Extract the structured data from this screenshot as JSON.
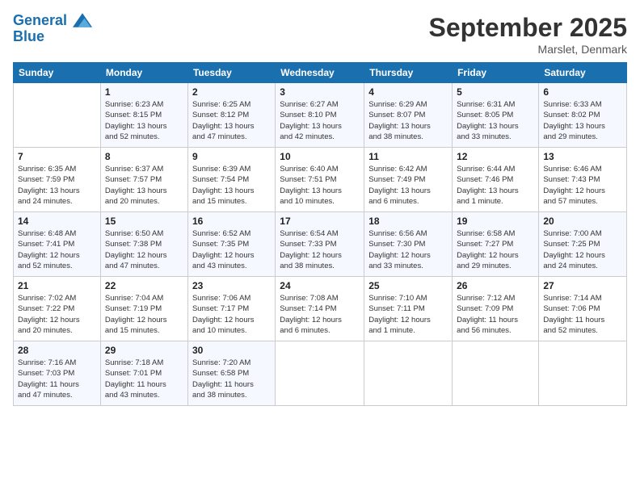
{
  "logo": {
    "line1": "General",
    "line2": "Blue"
  },
  "title": "September 2025",
  "location": "Marslet, Denmark",
  "days_header": [
    "Sunday",
    "Monday",
    "Tuesday",
    "Wednesday",
    "Thursday",
    "Friday",
    "Saturday"
  ],
  "weeks": [
    [
      {
        "num": "",
        "info": ""
      },
      {
        "num": "1",
        "info": "Sunrise: 6:23 AM\nSunset: 8:15 PM\nDaylight: 13 hours\nand 52 minutes."
      },
      {
        "num": "2",
        "info": "Sunrise: 6:25 AM\nSunset: 8:12 PM\nDaylight: 13 hours\nand 47 minutes."
      },
      {
        "num": "3",
        "info": "Sunrise: 6:27 AM\nSunset: 8:10 PM\nDaylight: 13 hours\nand 42 minutes."
      },
      {
        "num": "4",
        "info": "Sunrise: 6:29 AM\nSunset: 8:07 PM\nDaylight: 13 hours\nand 38 minutes."
      },
      {
        "num": "5",
        "info": "Sunrise: 6:31 AM\nSunset: 8:05 PM\nDaylight: 13 hours\nand 33 minutes."
      },
      {
        "num": "6",
        "info": "Sunrise: 6:33 AM\nSunset: 8:02 PM\nDaylight: 13 hours\nand 29 minutes."
      }
    ],
    [
      {
        "num": "7",
        "info": "Sunrise: 6:35 AM\nSunset: 7:59 PM\nDaylight: 13 hours\nand 24 minutes."
      },
      {
        "num": "8",
        "info": "Sunrise: 6:37 AM\nSunset: 7:57 PM\nDaylight: 13 hours\nand 20 minutes."
      },
      {
        "num": "9",
        "info": "Sunrise: 6:39 AM\nSunset: 7:54 PM\nDaylight: 13 hours\nand 15 minutes."
      },
      {
        "num": "10",
        "info": "Sunrise: 6:40 AM\nSunset: 7:51 PM\nDaylight: 13 hours\nand 10 minutes."
      },
      {
        "num": "11",
        "info": "Sunrise: 6:42 AM\nSunset: 7:49 PM\nDaylight: 13 hours\nand 6 minutes."
      },
      {
        "num": "12",
        "info": "Sunrise: 6:44 AM\nSunset: 7:46 PM\nDaylight: 13 hours\nand 1 minute."
      },
      {
        "num": "13",
        "info": "Sunrise: 6:46 AM\nSunset: 7:43 PM\nDaylight: 12 hours\nand 57 minutes."
      }
    ],
    [
      {
        "num": "14",
        "info": "Sunrise: 6:48 AM\nSunset: 7:41 PM\nDaylight: 12 hours\nand 52 minutes."
      },
      {
        "num": "15",
        "info": "Sunrise: 6:50 AM\nSunset: 7:38 PM\nDaylight: 12 hours\nand 47 minutes."
      },
      {
        "num": "16",
        "info": "Sunrise: 6:52 AM\nSunset: 7:35 PM\nDaylight: 12 hours\nand 43 minutes."
      },
      {
        "num": "17",
        "info": "Sunrise: 6:54 AM\nSunset: 7:33 PM\nDaylight: 12 hours\nand 38 minutes."
      },
      {
        "num": "18",
        "info": "Sunrise: 6:56 AM\nSunset: 7:30 PM\nDaylight: 12 hours\nand 33 minutes."
      },
      {
        "num": "19",
        "info": "Sunrise: 6:58 AM\nSunset: 7:27 PM\nDaylight: 12 hours\nand 29 minutes."
      },
      {
        "num": "20",
        "info": "Sunrise: 7:00 AM\nSunset: 7:25 PM\nDaylight: 12 hours\nand 24 minutes."
      }
    ],
    [
      {
        "num": "21",
        "info": "Sunrise: 7:02 AM\nSunset: 7:22 PM\nDaylight: 12 hours\nand 20 minutes."
      },
      {
        "num": "22",
        "info": "Sunrise: 7:04 AM\nSunset: 7:19 PM\nDaylight: 12 hours\nand 15 minutes."
      },
      {
        "num": "23",
        "info": "Sunrise: 7:06 AM\nSunset: 7:17 PM\nDaylight: 12 hours\nand 10 minutes."
      },
      {
        "num": "24",
        "info": "Sunrise: 7:08 AM\nSunset: 7:14 PM\nDaylight: 12 hours\nand 6 minutes."
      },
      {
        "num": "25",
        "info": "Sunrise: 7:10 AM\nSunset: 7:11 PM\nDaylight: 12 hours\nand 1 minute."
      },
      {
        "num": "26",
        "info": "Sunrise: 7:12 AM\nSunset: 7:09 PM\nDaylight: 11 hours\nand 56 minutes."
      },
      {
        "num": "27",
        "info": "Sunrise: 7:14 AM\nSunset: 7:06 PM\nDaylight: 11 hours\nand 52 minutes."
      }
    ],
    [
      {
        "num": "28",
        "info": "Sunrise: 7:16 AM\nSunset: 7:03 PM\nDaylight: 11 hours\nand 47 minutes."
      },
      {
        "num": "29",
        "info": "Sunrise: 7:18 AM\nSunset: 7:01 PM\nDaylight: 11 hours\nand 43 minutes."
      },
      {
        "num": "30",
        "info": "Sunrise: 7:20 AM\nSunset: 6:58 PM\nDaylight: 11 hours\nand 38 minutes."
      },
      {
        "num": "",
        "info": ""
      },
      {
        "num": "",
        "info": ""
      },
      {
        "num": "",
        "info": ""
      },
      {
        "num": "",
        "info": ""
      }
    ]
  ]
}
